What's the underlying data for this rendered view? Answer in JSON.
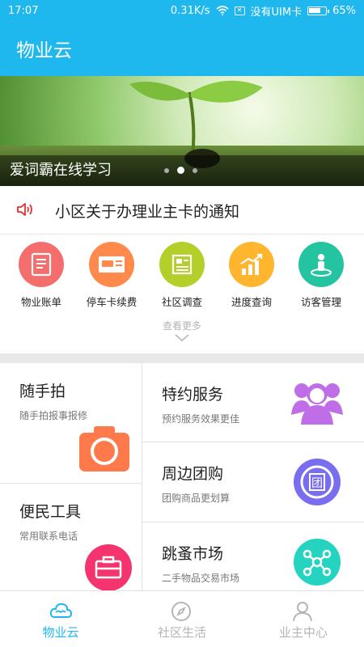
{
  "status_bar": {
    "time": "17:07",
    "speed": "0.31K/s",
    "sim": "没有UIM卡",
    "battery": "65%"
  },
  "app_bar": {
    "title": "物业云"
  },
  "banner": {
    "caption": "爱词霸在线学习",
    "slide_count": 3,
    "active_slide": 2
  },
  "notice": {
    "text": "小区关于办理业主卡的通知",
    "icon": "speaker-icon"
  },
  "services": [
    {
      "label": "物业账单",
      "icon": "bill-icon",
      "color": "#f56e6e"
    },
    {
      "label": "停车卡续费",
      "icon": "parking-card-icon",
      "color": "#ff8a4c"
    },
    {
      "label": "社区调查",
      "icon": "survey-icon",
      "color": "#b5cf2a"
    },
    {
      "label": "进度查询",
      "icon": "progress-chart-icon",
      "color": "#ffb52e"
    },
    {
      "label": "访客管理",
      "icon": "visitor-icon",
      "color": "#24c4a1"
    }
  ],
  "more_label": "查看更多",
  "cards": {
    "photo": {
      "title": "随手拍",
      "subtitle": "随手拍报事报修",
      "icon": "camera-icon",
      "color": "#ff7a4a"
    },
    "tools": {
      "title": "便民工具",
      "subtitle": "常用联系电话",
      "icon": "toolbox-icon",
      "color": "#f5336e"
    },
    "special": {
      "title": "特约服务",
      "subtitle": "预约服务效果更佳",
      "icon": "people-icon",
      "color": "#c06ee8"
    },
    "group": {
      "title": "周边团购",
      "subtitle": "团购商品更划算",
      "icon": "group-buy-icon",
      "color": "#7a6ef0"
    },
    "flea": {
      "title": "跳蚤市场",
      "subtitle": "二手物品交易市场",
      "icon": "network-icon",
      "color": "#24d4c0"
    }
  },
  "tabs": [
    {
      "label": "物业云",
      "icon": "cloud-icon",
      "active": true
    },
    {
      "label": "社区生活",
      "icon": "compass-icon",
      "active": false
    },
    {
      "label": "业主中心",
      "icon": "user-icon",
      "active": false
    }
  ],
  "colors": {
    "primary": "#1fb8ee",
    "inactive_tab": "#b5b5b5"
  }
}
